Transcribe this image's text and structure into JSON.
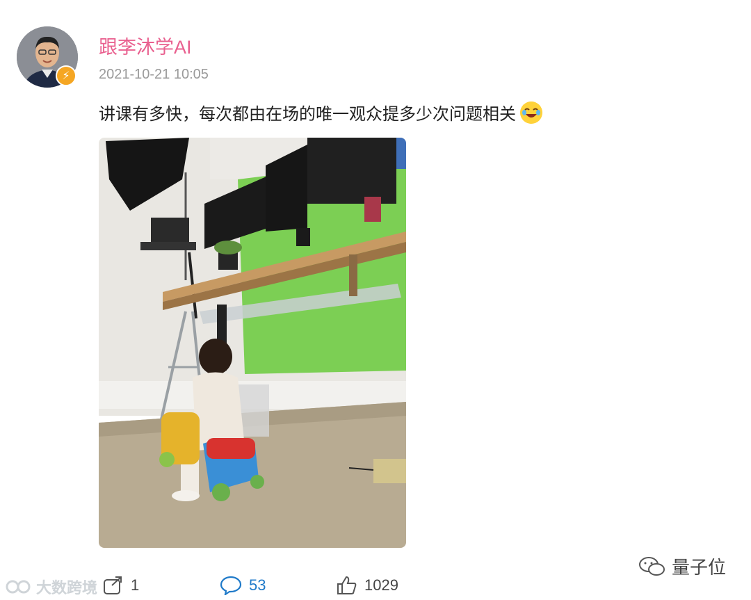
{
  "post": {
    "author": "跟李沐学AI",
    "timestamp": "2021-10-21 10:05",
    "text": "讲课有多快，每次都由在场的唯一观众提多少次问题相关",
    "emoji": "laughing-emoji"
  },
  "actions": {
    "repost_count": "1",
    "comment_count": "53",
    "like_count": "1029"
  },
  "watermarks": {
    "right": "量子位",
    "left": "大数跨境"
  },
  "colors": {
    "author_name": "#e9608f",
    "verified_badge": "#f5a623",
    "comment_accent": "#1f7ac9",
    "green_screen": "#7ccf54"
  }
}
